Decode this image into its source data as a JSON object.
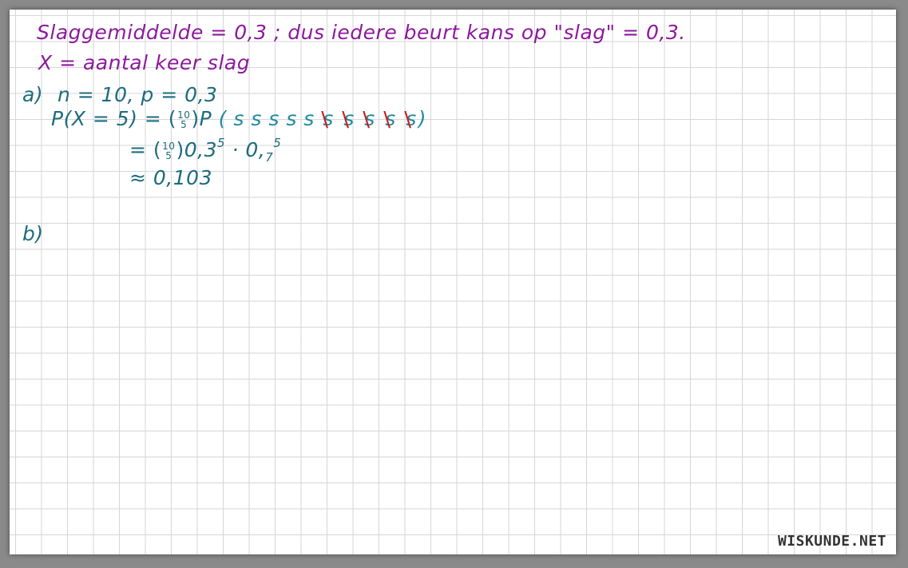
{
  "lines": {
    "line1": "Slaggemiddelde = 0,3 ; dus iedere beurt kans op \"slag\" = 0,3.",
    "line2": "X = aantal keer slag",
    "label_a": "a)",
    "line_a1": "n = 10,  p = 0,3",
    "line_a2_lhs": "P(X = 5) = ",
    "binom_top": "10",
    "binom_bottom": "5",
    "prob_P": "P",
    "paren_open": "(",
    "paren_close": ")",
    "s_plain": "s",
    "s_crossed": "s",
    "cross_mark": "\\",
    "equals": "=",
    "base1": "0,3",
    "exp1": "5",
    "dot": " · ",
    "base2": "0,",
    "sub2": "7",
    "exp2": "5",
    "approx": "≈",
    "result": "0,103",
    "label_b": "b)"
  },
  "logo": "WISKUNDE.NET",
  "colors": {
    "purple": "#8c1a9c",
    "teal": "#1d6c7e",
    "teal_light": "#1f8aa0",
    "red": "#d01818"
  }
}
